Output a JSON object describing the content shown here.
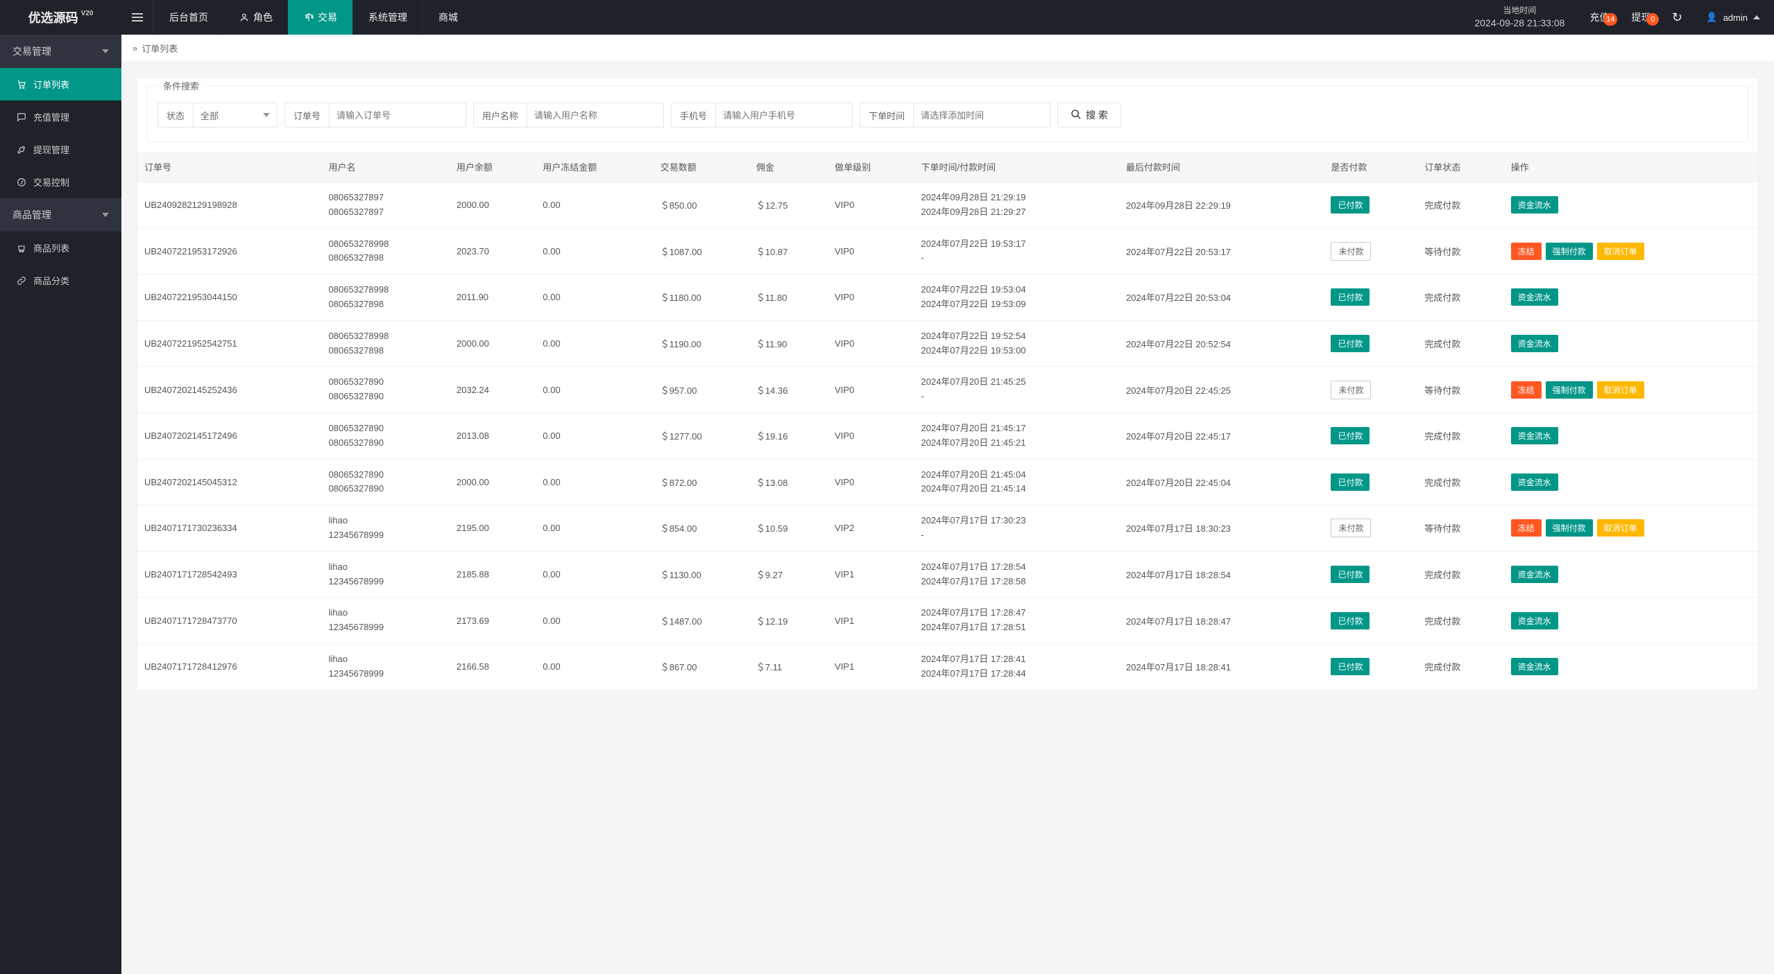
{
  "logo": {
    "name": "优选源码",
    "version": "V20"
  },
  "nav": [
    {
      "label": "后台首页",
      "icon": null
    },
    {
      "label": "角色",
      "icon": "user"
    },
    {
      "label": "交易",
      "icon": "scale",
      "active": true
    },
    {
      "label": "系统管理",
      "icon": null
    },
    {
      "label": "商城",
      "icon": null
    }
  ],
  "top_right": {
    "time_label": "当地时间",
    "time_value": "2024-09-28 21:33:08",
    "recharge_label": "充值",
    "recharge_badge": "14",
    "withdraw_label": "提现",
    "withdraw_badge": "0",
    "user_name": "admin"
  },
  "sidebar": {
    "groups": [
      {
        "title": "交易管理",
        "items": [
          {
            "label": "订单列表",
            "icon": "cart",
            "active": true
          },
          {
            "label": "充值管理",
            "icon": "comment"
          },
          {
            "label": "提现管理",
            "icon": "wrench"
          },
          {
            "label": "交易控制",
            "icon": "dashboard"
          }
        ]
      },
      {
        "title": "商品管理",
        "items": [
          {
            "label": "商品列表",
            "icon": "cart2"
          },
          {
            "label": "商品分类",
            "icon": "link"
          }
        ]
      }
    ]
  },
  "breadcrumb": {
    "sep": "»",
    "current": "订单列表"
  },
  "search": {
    "legend": "条件搜索",
    "status_label": "状态",
    "status_value": "全部",
    "order_label": "订单号",
    "order_placeholder": "请输入订单号",
    "user_label": "用户名称",
    "user_placeholder": "请输入用户名称",
    "phone_label": "手机号",
    "phone_placeholder": "请输入用户手机号",
    "time_label": "下单时间",
    "time_placeholder": "请选择添加时间",
    "search_btn": "搜 索"
  },
  "columns": [
    "订单号",
    "用户名",
    "用户余额",
    "用户冻结金额",
    "交易数额",
    "佣金",
    "做单级别",
    "下单时间/付款时间",
    "最后付款时间",
    "是否付款",
    "订单状态",
    "操作"
  ],
  "status_tags": {
    "paid": "已付款",
    "unpaid": "未付款",
    "state_done": "完成付款",
    "state_wait": "等待付款",
    "act_flow": "资金流水",
    "act_freeze": "冻结",
    "act_force": "强制付款",
    "act_cancel": "取消订单"
  },
  "rows": [
    {
      "order": "UB2409282129198928",
      "userA": "08065327897",
      "userB": "08065327897",
      "balance": "2000.00",
      "frozen": "0.00",
      "amount": "＄850.00",
      "commission": "＄12.75",
      "level": "VIP0",
      "t1": "2024年09月28日 21:29:19",
      "t2": "2024年09月28日 21:29:27",
      "last": "2024年09月28日 22:29:19",
      "paid": true
    },
    {
      "order": "UB2407221953172926",
      "userA": "080653278998",
      "userB": "08065327898",
      "balance": "2023.70",
      "frozen": "0.00",
      "amount": "＄1087.00",
      "commission": "＄10.87",
      "level": "VIP0",
      "t1": "2024年07月22日 19:53:17",
      "t2": "-",
      "last": "2024年07月22日 20:53:17",
      "paid": false
    },
    {
      "order": "UB2407221953044150",
      "userA": "080653278998",
      "userB": "08065327898",
      "balance": "2011.90",
      "frozen": "0.00",
      "amount": "＄1180.00",
      "commission": "＄11.80",
      "level": "VIP0",
      "t1": "2024年07月22日 19:53:04",
      "t2": "2024年07月22日 19:53:09",
      "last": "2024年07月22日 20:53:04",
      "paid": true
    },
    {
      "order": "UB2407221952542751",
      "userA": "080653278998",
      "userB": "08065327898",
      "balance": "2000.00",
      "frozen": "0.00",
      "amount": "＄1190.00",
      "commission": "＄11.90",
      "level": "VIP0",
      "t1": "2024年07月22日 19:52:54",
      "t2": "2024年07月22日 19:53:00",
      "last": "2024年07月22日 20:52:54",
      "paid": true
    },
    {
      "order": "UB2407202145252436",
      "userA": "08065327890",
      "userB": "08065327890",
      "balance": "2032.24",
      "frozen": "0.00",
      "amount": "＄957.00",
      "commission": "＄14.36",
      "level": "VIP0",
      "t1": "2024年07月20日 21:45:25",
      "t2": "-",
      "last": "2024年07月20日 22:45:25",
      "paid": false
    },
    {
      "order": "UB2407202145172496",
      "userA": "08065327890",
      "userB": "08065327890",
      "balance": "2013.08",
      "frozen": "0.00",
      "amount": "＄1277.00",
      "commission": "＄19.16",
      "level": "VIP0",
      "t1": "2024年07月20日 21:45:17",
      "t2": "2024年07月20日 21:45:21",
      "last": "2024年07月20日 22:45:17",
      "paid": true
    },
    {
      "order": "UB2407202145045312",
      "userA": "08065327890",
      "userB": "08065327890",
      "balance": "2000.00",
      "frozen": "0.00",
      "amount": "＄872.00",
      "commission": "＄13.08",
      "level": "VIP0",
      "t1": "2024年07月20日 21:45:04",
      "t2": "2024年07月20日 21:45:14",
      "last": "2024年07月20日 22:45:04",
      "paid": true
    },
    {
      "order": "UB2407171730236334",
      "userA": "lihao",
      "userB": "12345678999",
      "balance": "2195.00",
      "frozen": "0.00",
      "amount": "＄854.00",
      "commission": "＄10.59",
      "level": "VIP2",
      "t1": "2024年07月17日 17:30:23",
      "t2": "-",
      "last": "2024年07月17日 18:30:23",
      "paid": false
    },
    {
      "order": "UB2407171728542493",
      "userA": "lihao",
      "userB": "12345678999",
      "balance": "2185.88",
      "frozen": "0.00",
      "amount": "＄1130.00",
      "commission": "＄9.27",
      "level": "VIP1",
      "t1": "2024年07月17日 17:28:54",
      "t2": "2024年07月17日 17:28:58",
      "last": "2024年07月17日 18:28:54",
      "paid": true
    },
    {
      "order": "UB2407171728473770",
      "userA": "lihao",
      "userB": "12345678999",
      "balance": "2173.69",
      "frozen": "0.00",
      "amount": "＄1487.00",
      "commission": "＄12.19",
      "level": "VIP1",
      "t1": "2024年07月17日 17:28:47",
      "t2": "2024年07月17日 17:28:51",
      "last": "2024年07月17日 18:28:47",
      "paid": true
    },
    {
      "order": "UB2407171728412976",
      "userA": "lihao",
      "userB": "12345678999",
      "balance": "2166.58",
      "frozen": "0.00",
      "amount": "＄867.00",
      "commission": "＄7.11",
      "level": "VIP1",
      "t1": "2024年07月17日 17:28:41",
      "t2": "2024年07月17日 17:28:44",
      "last": "2024年07月17日 18:28:41",
      "paid": true
    }
  ]
}
